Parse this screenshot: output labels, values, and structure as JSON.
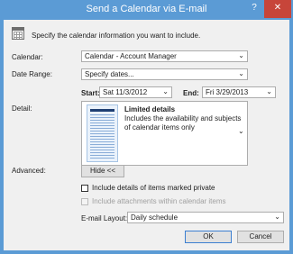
{
  "window": {
    "title": "Send a Calendar via E-mail",
    "help_glyph": "?",
    "close_glyph": "✕"
  },
  "instructions": "Specify the calendar information you want to include.",
  "calendar": {
    "label": "Calendar:",
    "value": "Calendar - Account Manager"
  },
  "date_range": {
    "label": "Date Range:",
    "value": "Specify dates...",
    "start_label": "Start:",
    "start_value": "Sat 11/3/2012",
    "end_label": "End:",
    "end_value": "Fri 3/29/2013"
  },
  "detail": {
    "label": "Detail:",
    "title": "Limited details",
    "description": "Includes the availability and subjects of calendar items only"
  },
  "advanced": {
    "label": "Advanced:",
    "toggle_label": "Hide <<"
  },
  "options": {
    "private_label": "Include details of items marked private",
    "attachments_label": "Include attachments within calendar items"
  },
  "email_layout": {
    "label": "E-mail Layout:",
    "value": "Daily schedule"
  },
  "buttons": {
    "ok": "OK",
    "cancel": "Cancel"
  },
  "icons": {
    "dropdown": "⌄",
    "calendar": "calendar-icon"
  }
}
